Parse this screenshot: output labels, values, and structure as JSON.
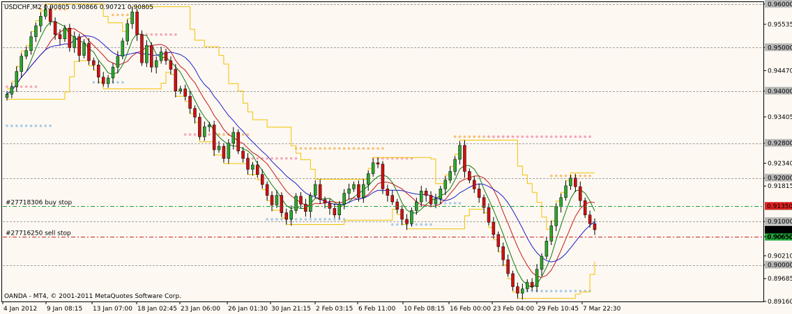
{
  "header": {
    "symbol_line": "USDCHF,M2  0.90805 0.90866 0.90721 0.90805"
  },
  "footer": {
    "copyright": "OANDA - MT4, © 2001-2011 MetaQuotes Software Corp."
  },
  "orders": [
    {
      "label": "#27718306 buy stop",
      "price": 0.9135,
      "tag": "0.91350",
      "color": "#1B9E2A",
      "tag_bg": "#22A83A"
    },
    {
      "label": "#27716250 sell stop",
      "price": 0.9065,
      "tag": "0.90650",
      "color": "#C81E1E",
      "tag_bg": "#22A83A"
    }
  ],
  "colors": {
    "background": "#FDF8F2",
    "bull_candle": "#2EA52E",
    "bear_candle": "#D01010",
    "ma_fast": "#0E7A0E",
    "ma_mid": "#C01818",
    "ma_slow": "#1E1EC8",
    "envelope": "#F2C200",
    "dots_upper_pink": "#F4A6B8",
    "dots_upper_orange": "#F8C07A",
    "dots_lower_blue": "#A8CCE8",
    "grid": "#A0A0A0",
    "current_price_bg": "#000000",
    "price_tag_bg": "#B8B8B8"
  },
  "chart_data": {
    "type": "candlestick",
    "title": "USDCHF,M2",
    "ohlc_header": {
      "open": 0.90805,
      "high": 0.90866,
      "low": 0.90721,
      "close": 0.90805
    },
    "ylim": [
      0.8916,
      0.9603
    ],
    "y_ticks": [
      "0.96000",
      "0.95535",
      "0.95000",
      "0.94470",
      "0.94000",
      "0.93405",
      "0.92800",
      "0.92340",
      "0.92000",
      "0.91815",
      "0.91000",
      "0.90650",
      "0.90210",
      "0.90000",
      "0.89685",
      "0.89160"
    ],
    "highlighted_levels": [
      {
        "price": 0.96,
        "label": "0.96000"
      },
      {
        "price": 0.95,
        "label": "0.95000"
      },
      {
        "price": 0.94,
        "label": "0.94000"
      },
      {
        "price": 0.928,
        "label": "0.92800"
      },
      {
        "price": 0.92,
        "label": "0.92000"
      },
      {
        "price": 0.91,
        "label": "0.91000"
      },
      {
        "price": 0.9,
        "label": "0.90000"
      }
    ],
    "current_price": {
      "value": 0.90805,
      "label": "0.90805"
    },
    "red_tag": {
      "value": 0.9135,
      "label": "0.91350"
    },
    "x_labels": [
      "4 Jan 2012",
      "9 Jan 08:15",
      "13 Jan 07:00",
      "18 Jan 02:45",
      "23 Jan 06:00",
      "26 Jan 01:30",
      "30 Jan 21:15",
      "2 Feb 03:15",
      "6 Feb 11:00",
      "10 Feb 08:15",
      "16 Feb 00:00",
      "23 Feb 04:00",
      "29 Feb 10:45",
      "7 Mar 22:30"
    ],
    "closes": [
      0.9393,
      0.941,
      0.9445,
      0.948,
      0.9493,
      0.9525,
      0.955,
      0.9572,
      0.9588,
      0.956,
      0.953,
      0.952,
      0.9545,
      0.95,
      0.9525,
      0.9482,
      0.951,
      0.947,
      0.946,
      0.9432,
      0.9417,
      0.943,
      0.9455,
      0.948,
      0.9515,
      0.9555,
      0.9582,
      0.953,
      0.9465,
      0.9505,
      0.9455,
      0.947,
      0.949,
      0.947,
      0.945,
      0.94,
      0.9405,
      0.9388,
      0.936,
      0.934,
      0.9295,
      0.9318,
      0.9322,
      0.9265,
      0.9273,
      0.9245,
      0.928,
      0.9305,
      0.9262,
      0.9245,
      0.922,
      0.923,
      0.9208,
      0.9185,
      0.916,
      0.9138,
      0.916,
      0.912,
      0.9105,
      0.9125,
      0.9158,
      0.914,
      0.9123,
      0.916,
      0.9185,
      0.915,
      0.9142,
      0.913,
      0.9115,
      0.914,
      0.9165,
      0.9175,
      0.9185,
      0.9155,
      0.9185,
      0.921,
      0.9235,
      0.9232,
      0.9175,
      0.916,
      0.9145,
      0.9128,
      0.9105,
      0.9095,
      0.9125,
      0.9145,
      0.917,
      0.916,
      0.914,
      0.9152,
      0.9175,
      0.9195,
      0.9215,
      0.9243,
      0.9275,
      0.9215,
      0.9195,
      0.9175,
      0.9155,
      0.9132,
      0.9098,
      0.907,
      0.9042,
      0.9012,
      0.898,
      0.895,
      0.8935,
      0.8945,
      0.896,
      0.895,
      0.899,
      0.902,
      0.9055,
      0.909,
      0.9135,
      0.9155,
      0.9182,
      0.92,
      0.918,
      0.9148,
      0.9115,
      0.9095,
      0.9081
    ],
    "series": [
      {
        "name": "",
        "kind": "ma_fast"
      },
      {
        "name": "",
        "kind": "ma_mid"
      },
      {
        "name": "",
        "kind": "ma_slow"
      }
    ],
    "grid": true
  }
}
